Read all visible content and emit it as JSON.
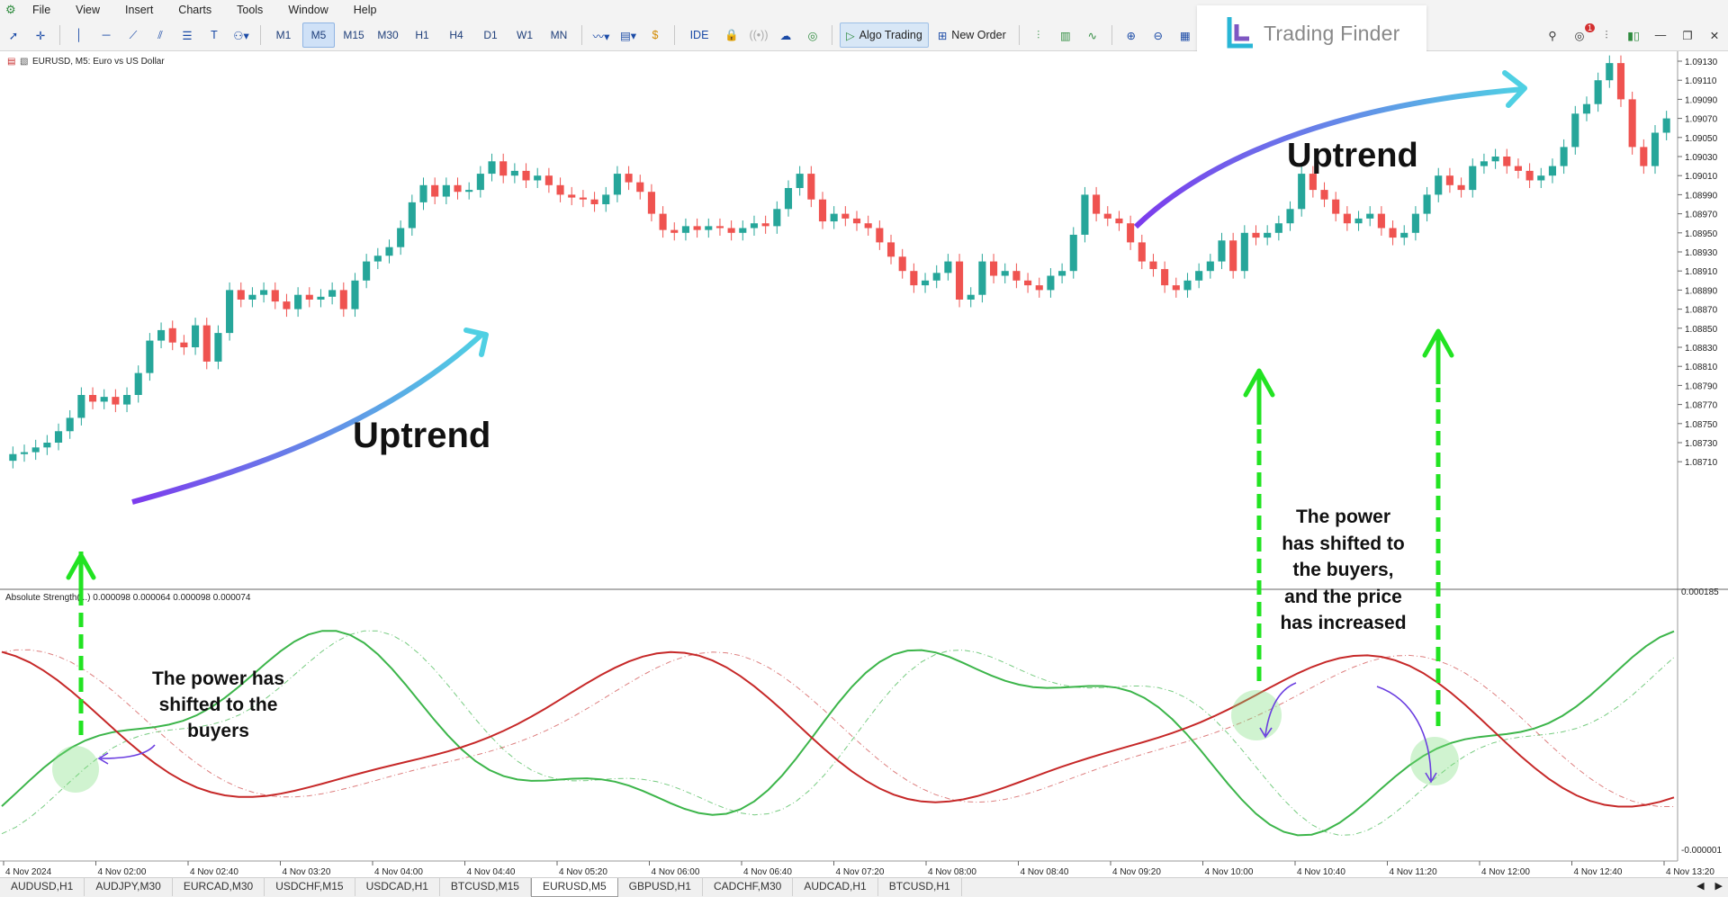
{
  "menu": [
    "File",
    "View",
    "Insert",
    "Charts",
    "Tools",
    "Window",
    "Help"
  ],
  "timeframes": [
    "M1",
    "M5",
    "M15",
    "M30",
    "H1",
    "H4",
    "D1",
    "W1",
    "MN"
  ],
  "active_timeframe": "M5",
  "toolbar": {
    "ide_label": "IDE",
    "algo_trading_label": "Algo Trading",
    "new_order_label": "New Order"
  },
  "brand": {
    "name": "Trading Finder"
  },
  "notification_count": "1",
  "chart": {
    "title": "EURUSD, M5:  Euro vs US Dollar",
    "indicator_label": "Absolute Strength(...) 0.000098 0.000064 0.000098 0.000074",
    "price_labels": [
      "1.09130",
      "1.09110",
      "1.09090",
      "1.09070",
      "1.09050",
      "1.09030",
      "1.09010",
      "1.08990",
      "1.08970",
      "1.08950",
      "1.08930",
      "1.08910",
      "1.08890",
      "1.08870",
      "1.08850",
      "1.08830",
      "1.08810",
      "1.08790",
      "1.08770",
      "1.08750",
      "1.08730",
      "1.08710"
    ],
    "indicator_scale": [
      "0.000185",
      "-0.000001"
    ],
    "time_labels": [
      "4 Nov 2024",
      "4 Nov 02:00",
      "4 Nov 02:40",
      "4 Nov 03:20",
      "4 Nov 04:00",
      "4 Nov 04:40",
      "4 Nov 05:20",
      "4 Nov 06:00",
      "4 Nov 06:40",
      "4 Nov 07:20",
      "4 Nov 08:00",
      "4 Nov 08:40",
      "4 Nov 09:20",
      "4 Nov 10:00",
      "4 Nov 10:40",
      "4 Nov 11:20",
      "4 Nov 12:00",
      "4 Nov 12:40",
      "4 Nov 13:20"
    ],
    "closes": [
      1.08718,
      1.0872,
      1.08725,
      1.0873,
      1.08742,
      1.08756,
      1.0878,
      1.08773,
      1.08778,
      1.0877,
      1.0878,
      1.08803,
      1.08837,
      1.08848,
      1.08835,
      1.0883,
      1.08853,
      1.08815,
      1.08845,
      1.0889,
      1.0888,
      1.08885,
      1.0889,
      1.08878,
      1.0887,
      1.08885,
      1.0888,
      1.08883,
      1.0889,
      1.0887,
      1.089,
      1.0892,
      1.08926,
      1.08935,
      1.08955,
      1.08982,
      1.09,
      1.08988,
      1.09,
      1.08993,
      1.08995,
      1.09012,
      1.09025,
      1.0901,
      1.09015,
      1.09005,
      1.0901,
      1.09,
      1.0899,
      1.08987,
      1.08985,
      1.0898,
      1.0899,
      1.09012,
      1.09003,
      1.08993,
      1.0897,
      1.08953,
      1.0895,
      1.08957,
      1.08953,
      1.08957,
      1.08955,
      1.0895,
      1.08955,
      1.0896,
      1.08957,
      1.08975,
      1.08997,
      1.09012,
      1.08985,
      1.08962,
      1.0897,
      1.08965,
      1.0896,
      1.08955,
      1.0894,
      1.08925,
      1.0891,
      1.08895,
      1.089,
      1.08908,
      1.0892,
      1.0888,
      1.08885,
      1.0892,
      1.08905,
      1.0891,
      1.089,
      1.08895,
      1.0889,
      1.08905,
      1.0891,
      1.08948,
      1.0899,
      1.0897,
      1.08965,
      1.0896,
      1.0894,
      1.0892,
      1.08912,
      1.08895,
      1.0889,
      1.089,
      1.0891,
      1.0892,
      1.08942,
      1.0891,
      1.0895,
      1.08945,
      1.0895,
      1.0896,
      1.08975,
      1.09012,
      1.08995,
      1.08985,
      1.0897,
      1.0896,
      1.08965,
      1.0897,
      1.08955,
      1.08945,
      1.0895,
      1.0897,
      1.0899,
      1.0901,
      1.09,
      1.08995,
      1.0902,
      1.09025,
      1.0903,
      1.0902,
      1.09015,
      1.09005,
      1.0901,
      1.0902,
      1.0904,
      1.09075,
      1.09085,
      1.0911,
      1.09128,
      1.0909,
      1.0904,
      1.0902,
      1.09055,
      1.0907
    ],
    "opens": [
      1.08711,
      1.08718,
      1.0872,
      1.08725,
      1.0873,
      1.08742,
      1.08756,
      1.0878,
      1.08773,
      1.08778,
      1.0877,
      1.0878,
      1.08803,
      1.08837,
      1.0885,
      1.08835,
      1.0883,
      1.08853,
      1.08815,
      1.08845,
      1.0889,
      1.0888,
      1.08885,
      1.0889,
      1.08878,
      1.0887,
      1.08885,
      1.0888,
      1.08883,
      1.0889,
      1.0887,
      1.089,
      1.0892,
      1.08926,
      1.08935,
      1.08955,
      1.08982,
      1.09,
      1.08988,
      1.09,
      1.08993,
      1.08995,
      1.09012,
      1.09025,
      1.0901,
      1.09015,
      1.09005,
      1.0901,
      1.09,
      1.0899,
      1.08987,
      1.08985,
      1.0898,
      1.0899,
      1.09012,
      1.09003,
      1.08993,
      1.0897,
      1.08953,
      1.0895,
      1.08957,
      1.08953,
      1.08957,
      1.08955,
      1.0895,
      1.08955,
      1.0896,
      1.08957,
      1.08975,
      1.08997,
      1.09012,
      1.08985,
      1.08962,
      1.0897,
      1.08965,
      1.0896,
      1.08955,
      1.0894,
      1.08925,
      1.0891,
      1.08895,
      1.089,
      1.08908,
      1.0892,
      1.0888,
      1.08885,
      1.0892,
      1.08905,
      1.0891,
      1.089,
      1.08895,
      1.0889,
      1.08905,
      1.0891,
      1.08948,
      1.0899,
      1.0897,
      1.08965,
      1.0896,
      1.0894,
      1.0892,
      1.08912,
      1.08895,
      1.0889,
      1.089,
      1.0891,
      1.0892,
      1.08942,
      1.0891,
      1.0895,
      1.08945,
      1.0895,
      1.0896,
      1.08975,
      1.09012,
      1.08995,
      1.08985,
      1.0897,
      1.0896,
      1.08965,
      1.0897,
      1.08955,
      1.08945,
      1.0895,
      1.0897,
      1.0899,
      1.0901,
      1.09,
      1.08995,
      1.0902,
      1.09025,
      1.0903,
      1.0902,
      1.09015,
      1.09005,
      1.0901,
      1.0902,
      1.0904,
      1.09075,
      1.09085,
      1.0911,
      1.09128,
      1.0909,
      1.0904,
      1.0902,
      1.09055
    ],
    "colors": {
      "bull": "#26a69a",
      "bear": "#ef5350",
      "bull_line": "#3cb54a",
      "bear_line": "#c62828",
      "arrow_green": "#22e322"
    }
  },
  "annotations": {
    "uptrend_1": "Uptrend",
    "uptrend_2": "Uptrend",
    "buyers_left": [
      "The power has",
      "shifted to the",
      "buyers"
    ],
    "buyers_right": [
      "The power",
      "has shifted to",
      "the buyers,",
      "and the price",
      "has increased"
    ]
  },
  "tabs": [
    "AUDUSD,H1",
    "AUDJPY,M30",
    "EURCAD,M30",
    "USDCHF,M15",
    "USDCAD,H1",
    "BTCUSD,M15",
    "EURUSD,M5",
    "GBPUSD,H1",
    "CADCHF,M30",
    "AUDCAD,H1",
    "BTCUSD,H1"
  ],
  "active_tab": "EURUSD,M5"
}
